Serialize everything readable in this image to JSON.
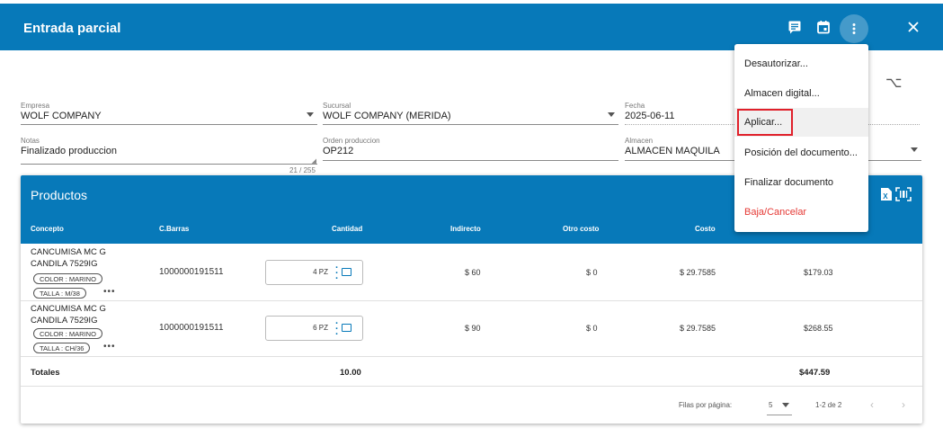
{
  "header": {
    "title": "Entrada parcial"
  },
  "form": {
    "empresa": {
      "label": "Empresa",
      "value": "WOLF COMPANY"
    },
    "sucursal": {
      "label": "Sucursal",
      "value": "WOLF COMPANY (MERIDA)"
    },
    "fecha": {
      "label": "Fecha",
      "value": "2025-06-11"
    },
    "notas": {
      "label": "Notas",
      "value": "Finalizado produccion",
      "counter": "21 / 255"
    },
    "orden": {
      "label": "Orden produccion",
      "value": "OP212"
    },
    "almacen": {
      "label": "Almacen",
      "value": "ALMACEN MAQUILA"
    }
  },
  "products": {
    "title": "Productos",
    "columns": [
      "Concepto",
      "C.Barras",
      "Cantidad",
      "Indirecto",
      "Otro costo",
      "Costo"
    ],
    "rows": [
      {
        "concept_line1": "CANCUMISA MC G",
        "concept_line2": "CANDILA 7529IG",
        "chip1": "COLOR : MARINO",
        "chip2": "TALLA : M/38",
        "more": "•••",
        "barcode": "1000000191511",
        "qty": "4 PZ",
        "indirecto": "$ 60",
        "otro": "$ 0",
        "costo": "$ 29.7585",
        "total": "$179.03"
      },
      {
        "concept_line1": "CANCUMISA MC G",
        "concept_line2": "CANDILA 7529IG",
        "chip1": "COLOR : MARINO",
        "chip2": "TALLA : CH/36",
        "more": "•••",
        "barcode": "1000000191511",
        "qty": "6 PZ",
        "indirecto": "$ 90",
        "otro": "$ 0",
        "costo": "$ 29.7585",
        "total": "$268.55"
      }
    ],
    "totals": {
      "label": "Totales",
      "qty": "10.00",
      "amount": "$447.59"
    },
    "pager": {
      "rows_label": "Filas por página:",
      "rows_value": "5",
      "range": "1-2 de 2"
    }
  },
  "menu": {
    "items": [
      "Desautorizar...",
      "Almacen digital...",
      "Aplicar...",
      "Posición del documento...",
      "Finalizar documento",
      "Baja/Cancelar"
    ]
  },
  "colors": {
    "primary": "#0779b9",
    "danger": "#e53935",
    "highlight_box": "#e0202a"
  },
  "icons": [
    "comment-icon",
    "calendar-icon",
    "more-vert-icon",
    "close-icon",
    "filter-icon",
    "excel-icon",
    "barcode-scan-icon"
  ]
}
